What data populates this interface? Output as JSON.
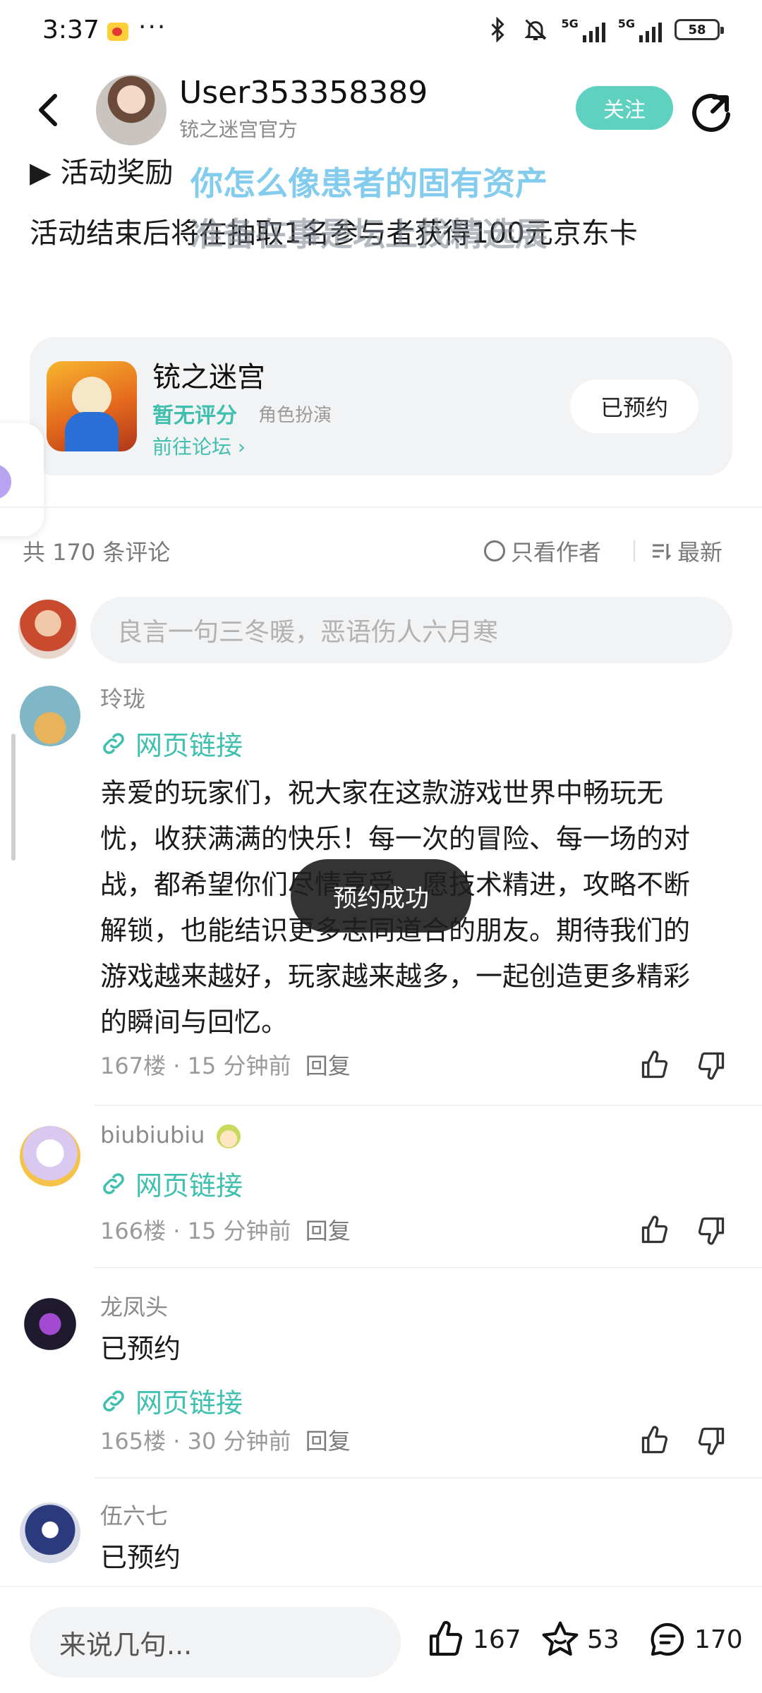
{
  "status_bar": {
    "time": "3:37",
    "more": "···",
    "network_1": "5G",
    "network_2": "5G",
    "battery": "58"
  },
  "header": {
    "author_name": "User353358389",
    "author_subtitle": "铳之迷宫官方",
    "follow_label": "关注"
  },
  "article": {
    "section_title": "▶ 活动奖励",
    "section_body": "活动结束后将在抽取1名参与者获得100元京东卡",
    "overlay_line_1": "你怎么像患者的固有资产",
    "overlay_line_2": "准备在事是坛上找精选展"
  },
  "game_card": {
    "name": "铳之迷宫",
    "rating": "暂无评分",
    "genre": "角色扮演",
    "forum_link": "前往论坛",
    "reserved_label": "已预约"
  },
  "comments_header": {
    "count_label": "共 170 条评论",
    "author_only_label": "只看作者",
    "sort_label": "最新"
  },
  "comment_input": {
    "placeholder": "良言一句三冬暖，恶语伤人六月寒"
  },
  "comments": [
    {
      "user": "玲珑",
      "link": "网页链接",
      "text": "亲爱的玩家们，祝大家在这款游戏世界中畅玩无忧，收获满满的快乐！每一次的冒险、每一场的对战，都希望你们尽情享受。愿技术精进，攻略不断解锁，也能结识更多志同道合的朋友。期待我们的游戏越来越好，玩家越来越多，一起创造更多精彩的瞬间与回忆。",
      "floor": "167楼",
      "time": "15 分钟前",
      "reply": "回复"
    },
    {
      "user": "biubiubiu",
      "link": "网页链接",
      "floor": "166楼",
      "time": "15 分钟前",
      "reply": "回复"
    },
    {
      "user": "龙凤头",
      "text": "已预约",
      "link": "网页链接",
      "floor": "165楼",
      "time": "30 分钟前",
      "reply": "回复"
    },
    {
      "user": "伍六七",
      "text": "已预约"
    }
  ],
  "toast": {
    "message": "预约成功"
  },
  "bottom_bar": {
    "input_placeholder": "来说几句...",
    "likes": "167",
    "favorites": "53",
    "comments": "170"
  },
  "colors": {
    "accent": "#5fd1c0",
    "link": "#3fbfae",
    "toast_bg": "#1e1e1e"
  }
}
